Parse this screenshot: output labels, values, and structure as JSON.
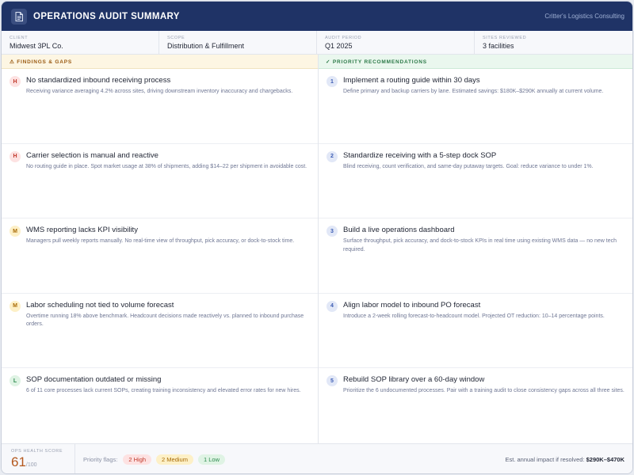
{
  "header": {
    "title": "OPERATIONS AUDIT SUMMARY",
    "consultant": "Critter's Logistics Consulting"
  },
  "meta": [
    {
      "label": "CLIENT",
      "value": "Midwest 3PL Co."
    },
    {
      "label": "SCOPE",
      "value": "Distribution & Fulfillment"
    },
    {
      "label": "AUDIT PERIOD",
      "value": "Q1 2025"
    },
    {
      "label": "SITES REVIEWED",
      "value": "3 facilities"
    }
  ],
  "findings": {
    "heading": "⚠ FINDINGS & GAPS",
    "items": [
      {
        "badge": "H",
        "title": "No standardized inbound receiving process",
        "desc": "Receiving variance averaging 4.2% across sites, driving downstream inventory inaccuracy and chargebacks."
      },
      {
        "badge": "H",
        "title": "Carrier selection is manual and reactive",
        "desc": "No routing guide in place. Spot market usage at 38% of shipments, adding $14–22 per shipment in avoidable cost."
      },
      {
        "badge": "M",
        "title": "WMS reporting lacks KPI visibility",
        "desc": "Managers pull weekly reports manually. No real-time view of throughput, pick accuracy, or dock-to-stock time."
      },
      {
        "badge": "M",
        "title": "Labor scheduling not tied to volume forecast",
        "desc": "Overtime running 18% above benchmark. Headcount decisions made reactively vs. planned to inbound purchase orders."
      },
      {
        "badge": "L",
        "title": "SOP documentation outdated or missing",
        "desc": "6 of 11 core processes lack current SOPs, creating training inconsistency and elevated error rates for new hires."
      }
    ]
  },
  "recommendations": {
    "heading": "✓ PRIORITY RECOMMENDATIONS",
    "items": [
      {
        "badge": "1",
        "title": "Implement a routing guide within 30 days",
        "desc": "Define primary and backup carriers by lane. Estimated savings: $180K–$290K annually at current volume."
      },
      {
        "badge": "2",
        "title": "Standardize receiving with a 5-step dock SOP",
        "desc": "Blind receiving, count verification, and same-day putaway targets. Goal: reduce variance to under 1%."
      },
      {
        "badge": "3",
        "title": "Build a live operations dashboard",
        "desc": "Surface throughput, pick accuracy, and dock-to-stock KPIs in real time using existing WMS data — no new tech required."
      },
      {
        "badge": "4",
        "title": "Align labor model to inbound PO forecast",
        "desc": "Introduce a 2-week rolling forecast-to-headcount model. Projected OT reduction: 10–14 percentage points."
      },
      {
        "badge": "5",
        "title": "Rebuild SOP library over a 60-day window",
        "desc": "Prioritize the 6 undocumented processes. Pair with a training audit to close consistency gaps across all three sites."
      }
    ]
  },
  "footer": {
    "score_label": "OPS HEALTH SCORE",
    "score": "61",
    "score_max": "/100",
    "flags_label": "Priority flags:",
    "flag_high": "2 High",
    "flag_medium": "2 Medium",
    "flag_low": "1 Low",
    "impact_label": "Est. annual impact if resolved:",
    "impact_value": "$290K–$470K"
  },
  "colors": {
    "header_bg": "#1f3366",
    "high": "#c0392b",
    "medium": "#a86a05",
    "low": "#2e8a4f",
    "score": "#b4581e"
  },
  "icons": {
    "header": "document-icon"
  }
}
